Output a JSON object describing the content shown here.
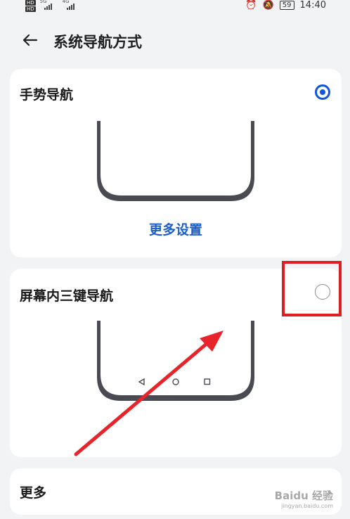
{
  "status_bar": {
    "hd_labels": [
      "HD",
      "HD"
    ],
    "net1": "5G",
    "net2": "4G",
    "battery": "59",
    "time": "14:40",
    "icons": [
      "alarm-icon",
      "mute-icon",
      "battery-icon"
    ]
  },
  "header": {
    "title": "系统导航方式",
    "back_icon": "arrow-left-icon"
  },
  "gesture_card": {
    "title": "手势导航",
    "selected": true,
    "more_settings": "更多设置"
  },
  "three_key_card": {
    "title": "屏幕内三键导航",
    "selected": false,
    "nav_icons": [
      "back-triangle-icon",
      "home-circle-icon",
      "recent-square-icon"
    ]
  },
  "more_card": {
    "title": "更多"
  },
  "watermark": {
    "line1": "Baidu 经验",
    "line2": "jingyan.baidu.com"
  },
  "colors": {
    "accent": "#1256e0",
    "link": "#1c5fc9",
    "highlight": "#e11d24",
    "background": "#f1f3f5"
  }
}
